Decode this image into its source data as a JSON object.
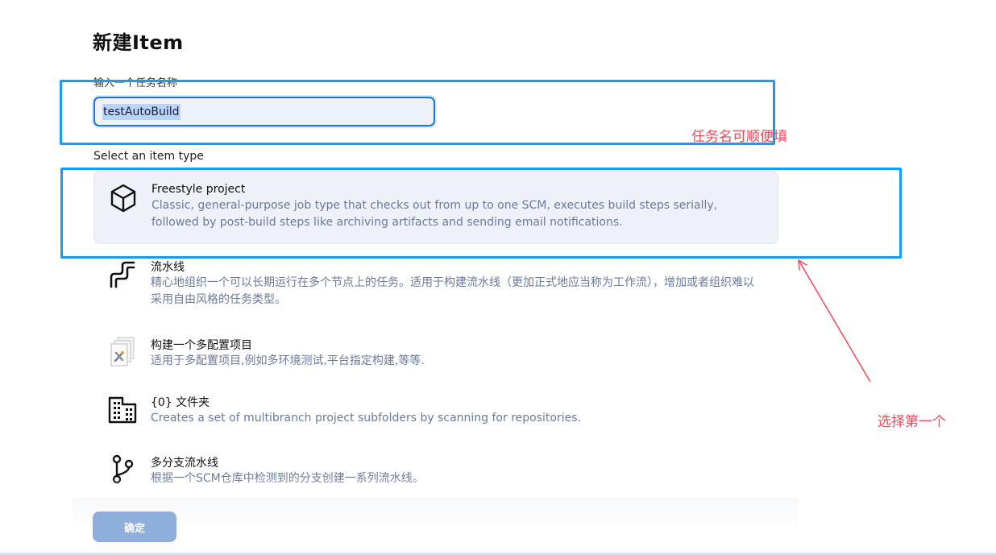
{
  "page": {
    "title": "新建Item",
    "name_label": "输入一个任务名称",
    "name_value": "testAutoBuild",
    "type_label": "Select an item type"
  },
  "items": [
    {
      "name": "Freestyle project",
      "description": "Classic, general-purpose job type that checks out from up to one SCM, executes build steps serially, followed by post-build steps like archiving artifacts and sending email notifications.",
      "icon": "freestyle-cube-icon",
      "selected": true
    },
    {
      "name": "流水线",
      "description": "精心地组织一个可以长期运行在多个节点上的任务。适用于构建流水线（更加正式地应当称为工作流），增加或者组织难以采用自由风格的任务类型。",
      "icon": "pipeline-icon",
      "selected": false
    },
    {
      "name": "构建一个多配置项目",
      "description": "适用于多配置项目,例如多环境测试,平台指定构建,等等.",
      "icon": "multi-config-icon",
      "selected": false
    },
    {
      "name": "{0} 文件夹",
      "description": "Creates a set of multibranch project subfolders by scanning for repositories.",
      "icon": "organization-folder-icon",
      "selected": false
    },
    {
      "name": "多分支流水线",
      "description": "根据一个SCM仓库中检测到的分支创建一系列流水线。",
      "icon": "multibranch-icon",
      "selected": false
    }
  ],
  "actions": {
    "ok_label": "确定"
  },
  "annotations": {
    "name_note": "任务名可顺便填",
    "select_note": "选择第一个",
    "box_color": "#1a9af5",
    "text_color": "#f04a5a"
  }
}
